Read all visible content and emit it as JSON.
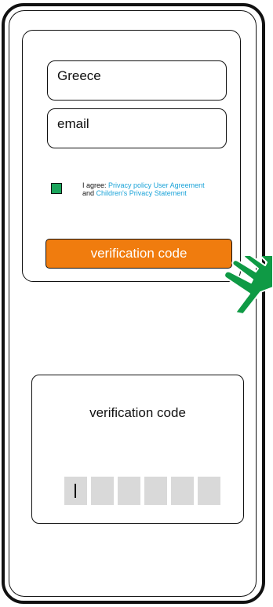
{
  "form": {
    "country_value": "Greece",
    "email_placeholder": "email",
    "consent": {
      "checked": true,
      "prefix": "I agree: ",
      "link_privacy": "Privacy policy",
      "link_user_agreement": "User Agreement",
      "conjunction": "and ",
      "link_children_privacy": "Children's Privacy Statement"
    },
    "submit_label": "verification code"
  },
  "code_panel": {
    "title": "verification code",
    "digit_count": 6
  },
  "colors": {
    "accent_orange": "#f07c0e",
    "checkbox_green": "#1aa45b",
    "link_blue": "#1aa3d8",
    "pointer_green": "#0f9a45"
  },
  "icons": {
    "pointer": "pointing-hand-icon"
  }
}
